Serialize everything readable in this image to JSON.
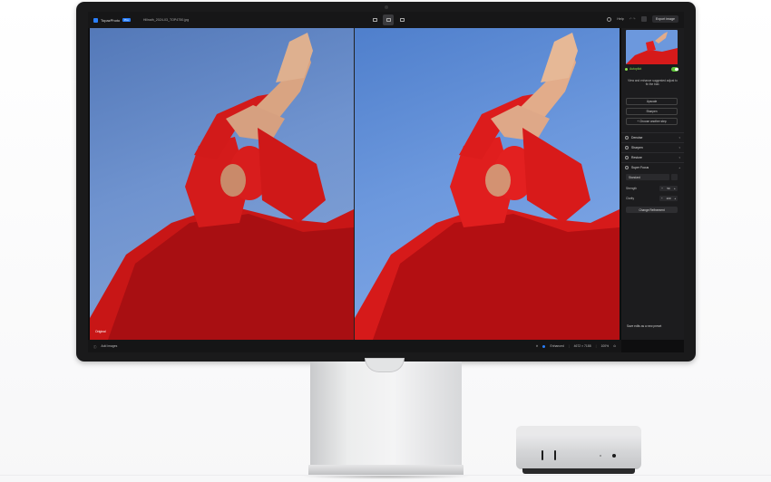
{
  "app": {
    "name": "TopazPhoto",
    "badge": "Pro",
    "file_name": "Hillnath_2024-03_TOP4750.jpg"
  },
  "titlebar": {
    "help_label": "Help",
    "undo_redo": "↶ ↷",
    "export_label": "Export image"
  },
  "image": {
    "left_tag": "Original"
  },
  "panel": {
    "autopilot_label": "Autopilot",
    "autopilot_text": "View and enhance suggested adjust to fix the bab.",
    "buttons": [
      {
        "label": "Upscale"
      },
      {
        "label": "Sharpen"
      },
      {
        "label": "+ Choose another step"
      }
    ],
    "sections": [
      {
        "label": "Denoise"
      },
      {
        "label": "Sharpen"
      },
      {
        "label": "Restore"
      },
      {
        "label": "Super Focus"
      }
    ],
    "super_focus": {
      "model_value": "Standard",
      "strength_label": "Strength",
      "strength_value": "50",
      "clarity_label": "Clarity",
      "clarity_value": "100",
      "change_button": "Change Refinement"
    },
    "save_preset": "Save edits as a new preset"
  },
  "bottombar": {
    "add_images": "Add images",
    "enhanced_label": "Enhanced",
    "dimensions": "4672 × 7188",
    "zoom": "100%"
  },
  "colors": {
    "accent": "#2a7fff",
    "autopilot_green": "#8be04e",
    "dress_red": "#d61a1a",
    "sky_blue": "#6c98dd"
  }
}
